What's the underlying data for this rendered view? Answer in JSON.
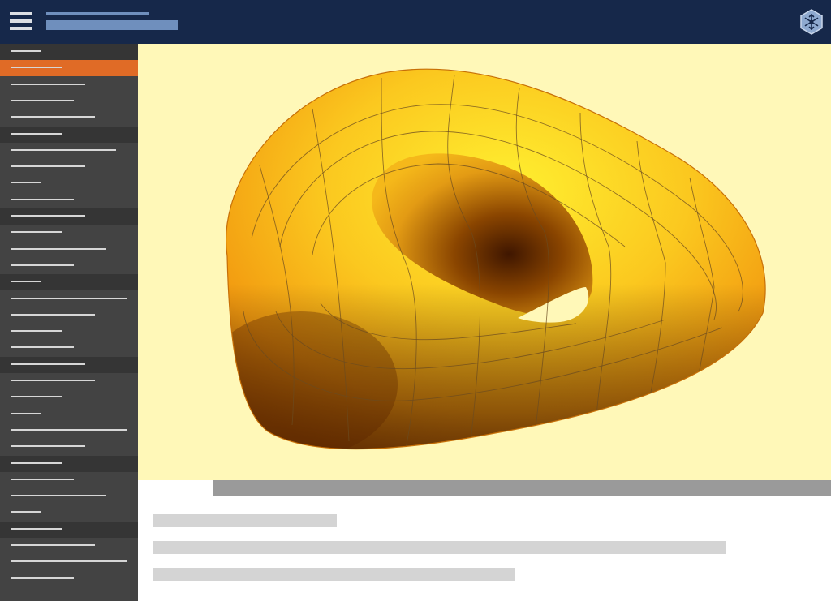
{
  "colors": {
    "header_bg": "#16284a",
    "header_placeholder": "#6f8fbd",
    "sidebar_bg": "#434343",
    "sidebar_section_bg": "#353535",
    "sidebar_active_bg": "#e06b26",
    "sidebar_line": "#d6d6d6",
    "viewport_bg": "#fff8b8",
    "torus_light": "#fff030",
    "torus_mid": "#f6a913",
    "torus_dark": "#4a1c00",
    "gridline": "#6b4b20",
    "scrollbar": "#9a9a9a",
    "text_placeholder": "#d4d4d4"
  },
  "icons": {
    "menu": "hamburger-menu-icon",
    "logo": "snowflake-hexagon-logo-icon"
  },
  "sidebar": {
    "items": [
      {
        "kind": "section",
        "line_width": 38
      },
      {
        "kind": "active",
        "line_width": 64
      },
      {
        "kind": "item",
        "line_width": 92
      },
      {
        "kind": "item",
        "line_width": 78
      },
      {
        "kind": "item",
        "line_width": 104
      },
      {
        "kind": "section",
        "line_width": 64
      },
      {
        "kind": "item",
        "line_width": 130
      },
      {
        "kind": "item",
        "line_width": 92
      },
      {
        "kind": "item",
        "line_width": 38
      },
      {
        "kind": "item",
        "line_width": 78
      },
      {
        "kind": "section",
        "line_width": 92
      },
      {
        "kind": "item",
        "line_width": 64
      },
      {
        "kind": "item",
        "line_width": 118
      },
      {
        "kind": "item",
        "line_width": 78
      },
      {
        "kind": "section",
        "line_width": 38
      },
      {
        "kind": "item",
        "line_width": 144
      },
      {
        "kind": "item",
        "line_width": 104
      },
      {
        "kind": "item",
        "line_width": 64
      },
      {
        "kind": "item",
        "line_width": 78
      },
      {
        "kind": "section",
        "line_width": 92
      },
      {
        "kind": "item",
        "line_width": 104
      },
      {
        "kind": "item",
        "line_width": 64
      },
      {
        "kind": "item",
        "line_width": 38
      },
      {
        "kind": "item",
        "line_width": 144
      },
      {
        "kind": "item",
        "line_width": 92
      },
      {
        "kind": "section",
        "line_width": 64
      },
      {
        "kind": "item",
        "line_width": 78
      },
      {
        "kind": "item",
        "line_width": 118
      },
      {
        "kind": "item",
        "line_width": 38
      },
      {
        "kind": "section",
        "line_width": 64
      },
      {
        "kind": "item",
        "line_width": 104
      },
      {
        "kind": "item",
        "line_width": 144
      },
      {
        "kind": "item",
        "line_width": 78
      }
    ]
  },
  "content": {
    "placeholder_lines": [
      {
        "width": 226
      },
      {
        "width": 706
      },
      {
        "width": 445
      }
    ]
  }
}
